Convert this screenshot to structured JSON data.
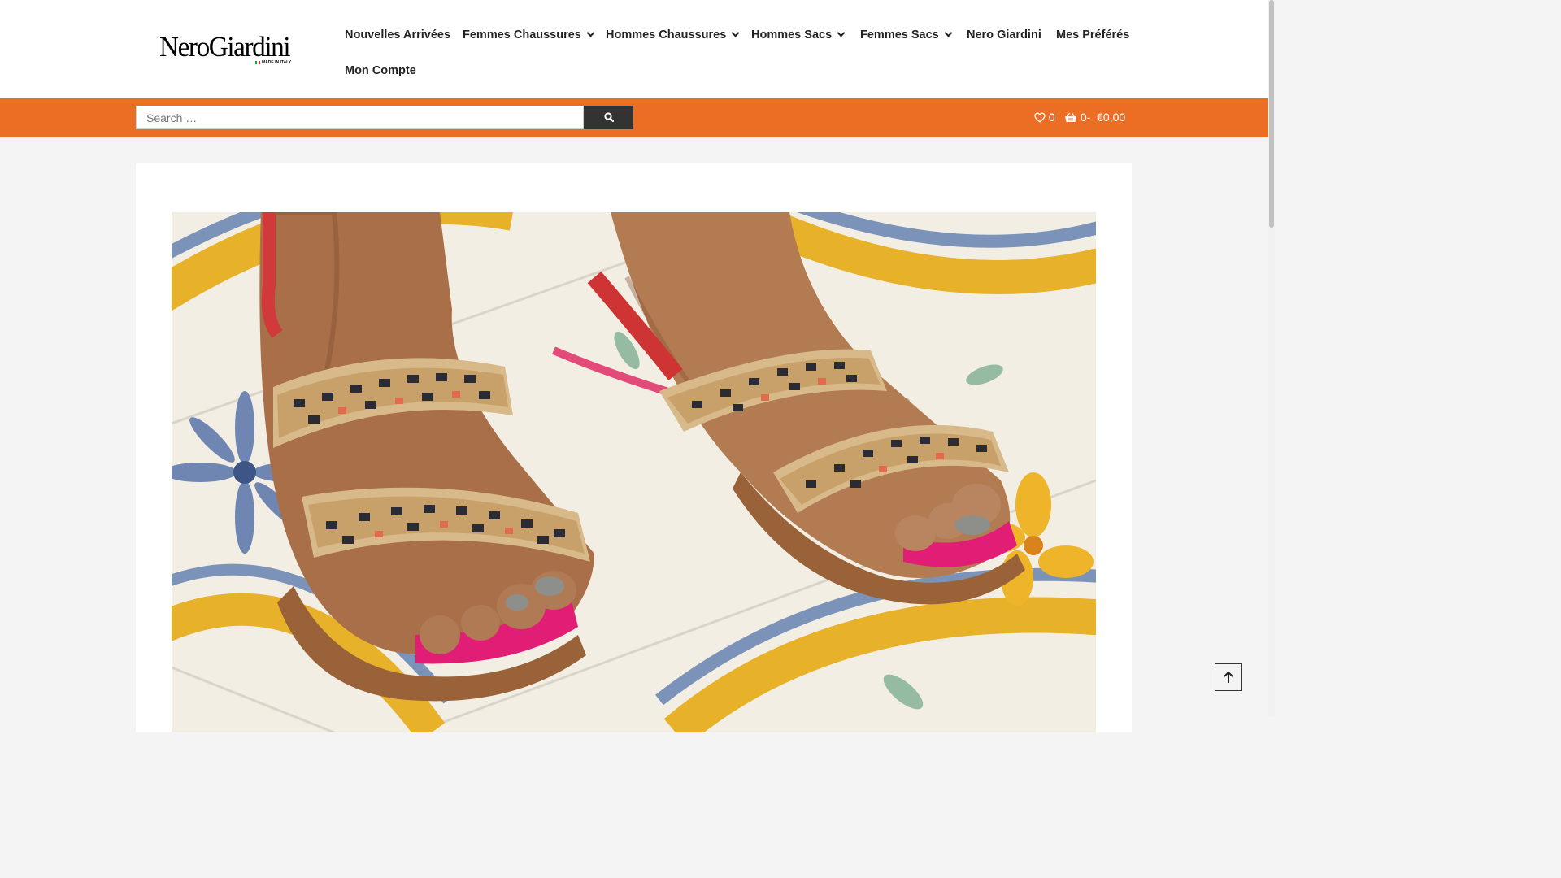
{
  "brand": {
    "logo_text": "NeroGiardini",
    "logo_tag": "MADE IN ITALY"
  },
  "nav": {
    "items": [
      {
        "label": "Nouvelles Arrivées",
        "dropdown": false
      },
      {
        "label": "Femmes Chaussures",
        "dropdown": true
      },
      {
        "label": "Hommes Chaussures",
        "dropdown": true
      },
      {
        "label": "Hommes Sacs",
        "dropdown": true
      },
      {
        "label": "Femmes Sacs",
        "dropdown": true
      },
      {
        "label": "Nero Giardini",
        "dropdown": false
      },
      {
        "label": "Mes Préférés",
        "dropdown": false
      },
      {
        "label": "Mon Compte",
        "dropdown": false
      }
    ]
  },
  "search": {
    "placeholder": "Search …",
    "value": "",
    "button_icon": "search-icon"
  },
  "wishlist": {
    "count": "0",
    "icon": "heart-icon"
  },
  "cart": {
    "count": "0",
    "separator": "-",
    "total": "€0,00",
    "icon": "basket-icon"
  },
  "colors": {
    "accent": "#ec6e25",
    "nav_text": "#222222",
    "search_button": "#333333"
  },
  "hero": {
    "subject": "woven raffia sandals on painted ceramic tiles"
  },
  "back_to_top": {
    "icon": "arrow-up-icon"
  }
}
